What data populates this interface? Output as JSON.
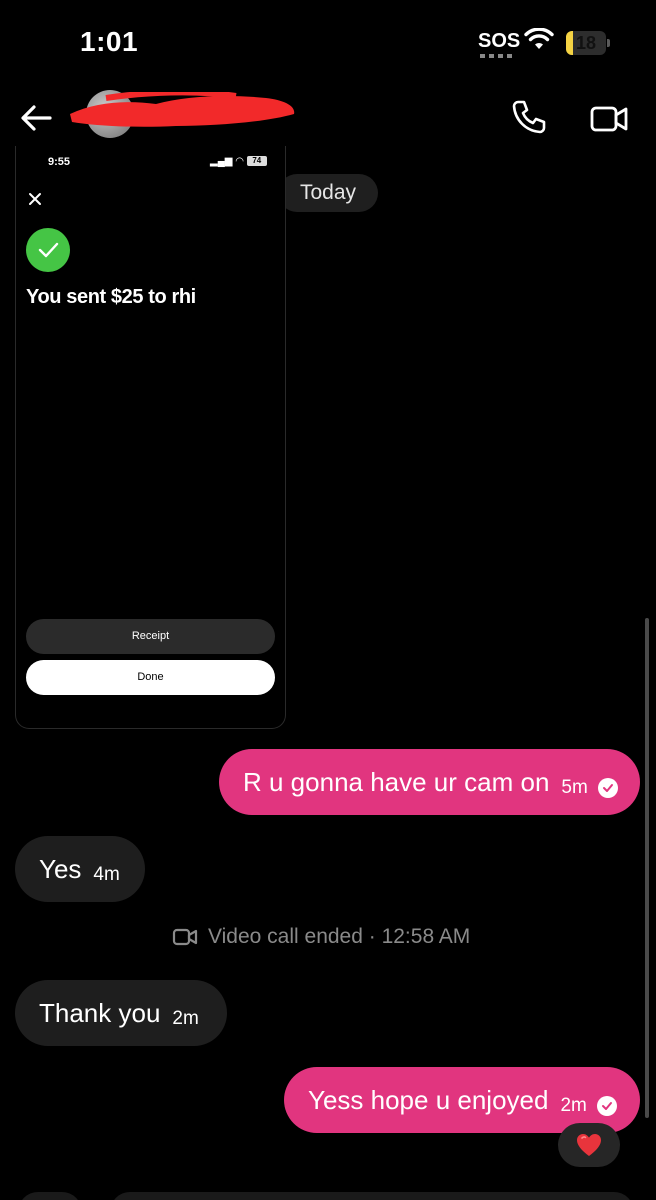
{
  "status_bar": {
    "time": "1:01",
    "sos": "SOS",
    "battery": "18",
    "battery_level": 0.18
  },
  "header": {
    "back_icon": "arrow-left-icon",
    "call_icon": "phone-icon",
    "video_icon": "video-camera-icon"
  },
  "date_separator": "Today",
  "shared_screenshot": {
    "time": "9:55",
    "battery": "74",
    "title": "You sent $25 to rhi",
    "receipt_label": "Receipt",
    "done_label": "Done",
    "colors": {
      "check": "#45c545"
    }
  },
  "messages": [
    {
      "direction": "out",
      "text": "R u gonna have ur cam on",
      "time": "5m",
      "seen": true
    },
    {
      "direction": "in",
      "text": "Yes",
      "time": "4m"
    },
    {
      "direction": "in",
      "text": "Thank you",
      "time": "2m"
    },
    {
      "direction": "out",
      "text": "Yess hope u enjoyed",
      "time": "2m",
      "seen": true,
      "reaction": "❤️"
    }
  ],
  "system_event": "Video call ended · 12:58 AM",
  "colors": {
    "outgoing_bubble": "#e1357f",
    "incoming_bubble": "#1e1e1e",
    "background": "#000000"
  }
}
